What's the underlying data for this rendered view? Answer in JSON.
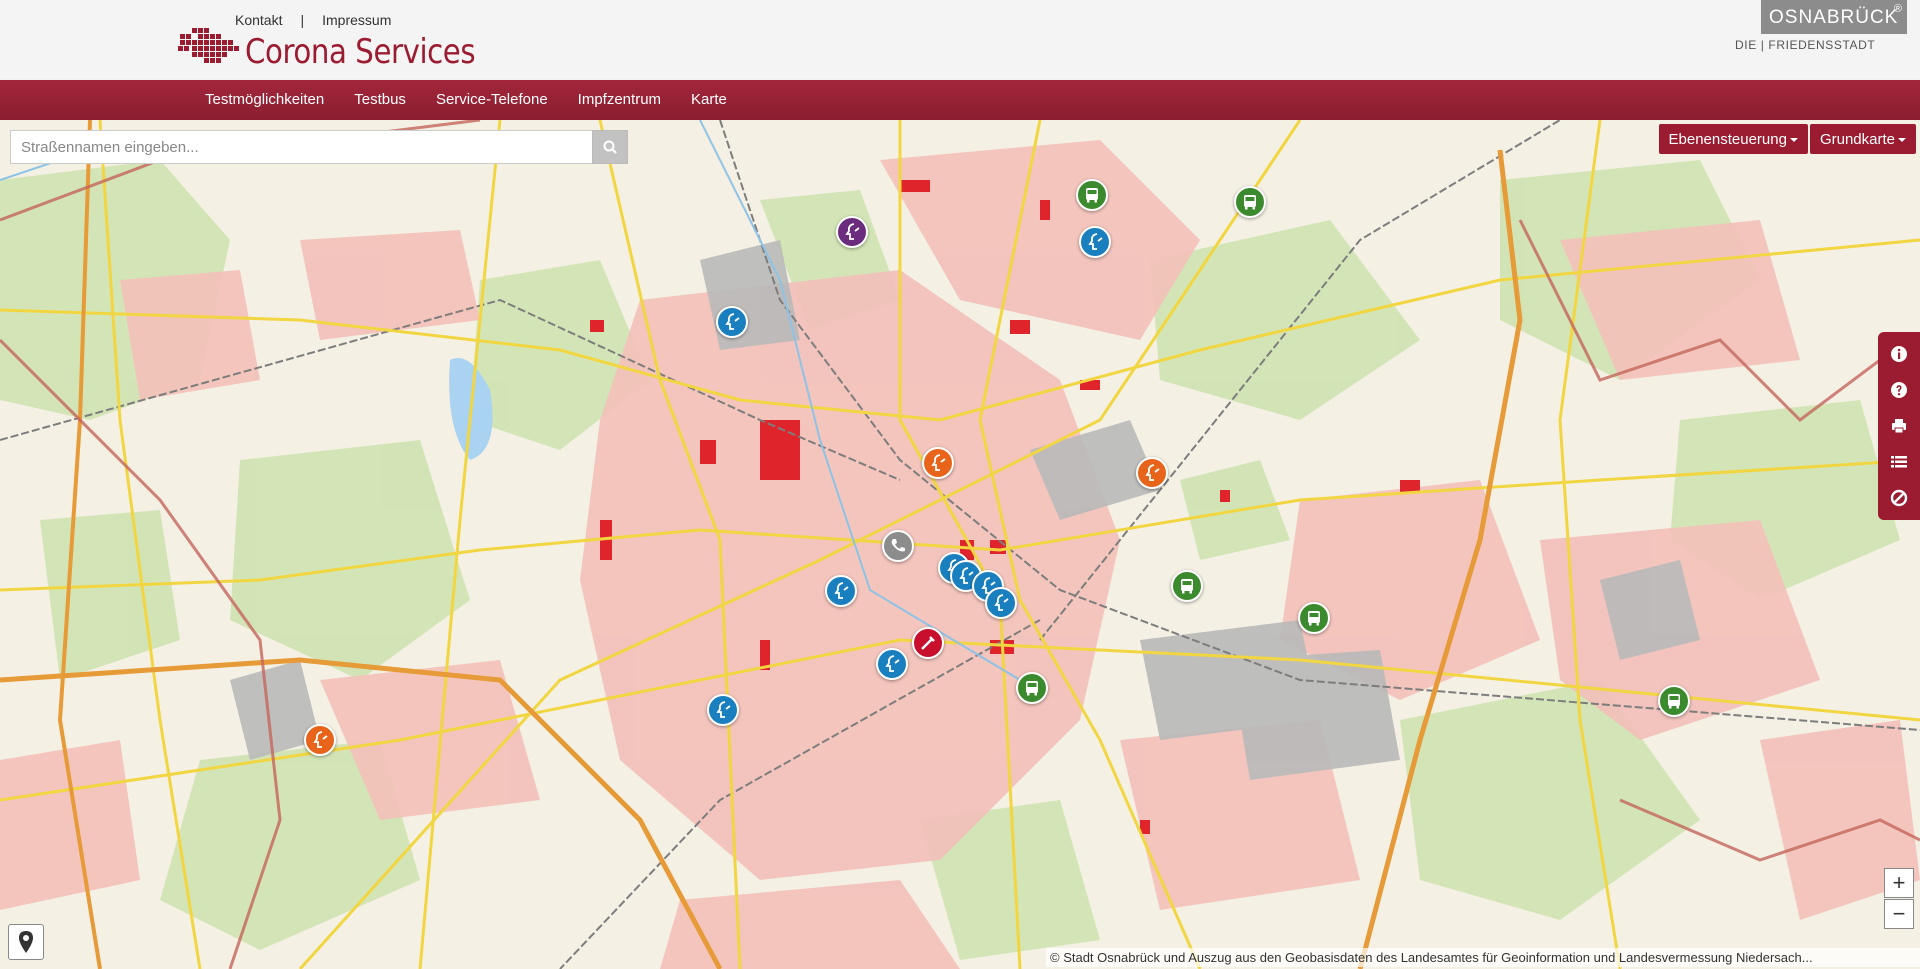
{
  "header": {
    "top_links": {
      "contact": "Kontakt",
      "separator": "|",
      "imprint": "Impressum"
    },
    "brand_title": "Corona Services",
    "city_logo": "OSNABRÜCK",
    "city_logo_mark": "®",
    "city_slogan": "DIE | FRIEDENSSTADT"
  },
  "nav": {
    "items": [
      {
        "label": "Testmöglichkeiten"
      },
      {
        "label": "Testbus"
      },
      {
        "label": "Service-Telefone"
      },
      {
        "label": "Impfzentrum"
      },
      {
        "label": "Karte"
      }
    ]
  },
  "map": {
    "search": {
      "placeholder": "Straßennamen eingeben..."
    },
    "layer_controls": {
      "layers": "Ebenensteuerung",
      "basemap": "Grundkarte"
    },
    "zoom": {
      "in": "+",
      "out": "−"
    },
    "attribution": "© Stadt Osnabrück und Auszug aus den Geobasisdaten des Landesamtes für Geoinformation und Landesvermessung Niedersach...",
    "colors": {
      "brand": "#9b1b30",
      "test_site": "#1a7fbf",
      "test_bus": "#3c8a2e",
      "vaccination_center": "#c8102e",
      "orange_site": "#e8641b",
      "purple_site": "#6b2c7e",
      "phone": "#8c8c8c"
    },
    "marker_types": {
      "test_site": "person-test-icon",
      "test_bus": "bus-icon",
      "vaccination_center": "syringe-icon",
      "phone": "phone-icon"
    }
  }
}
